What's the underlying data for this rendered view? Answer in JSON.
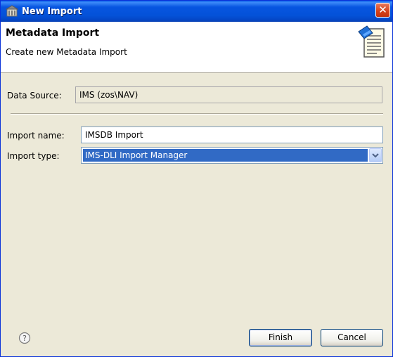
{
  "window": {
    "title": "New Import",
    "close_symbol": "✕"
  },
  "banner": {
    "title": "Metadata Import",
    "description": "Create new Metadata Import",
    "icon": "metadata-document-icon"
  },
  "form": {
    "data_source_label": "Data Source:",
    "data_source_value": "IMS (zos\\NAV)",
    "import_name_label": "Import name:",
    "import_name_value": "IMSDB Import",
    "import_type_label": "Import type:",
    "import_type_value": "IMS-DLI Import Manager"
  },
  "footer": {
    "help_symbol": "?",
    "finish_label": "Finish",
    "cancel_label": "Cancel"
  }
}
